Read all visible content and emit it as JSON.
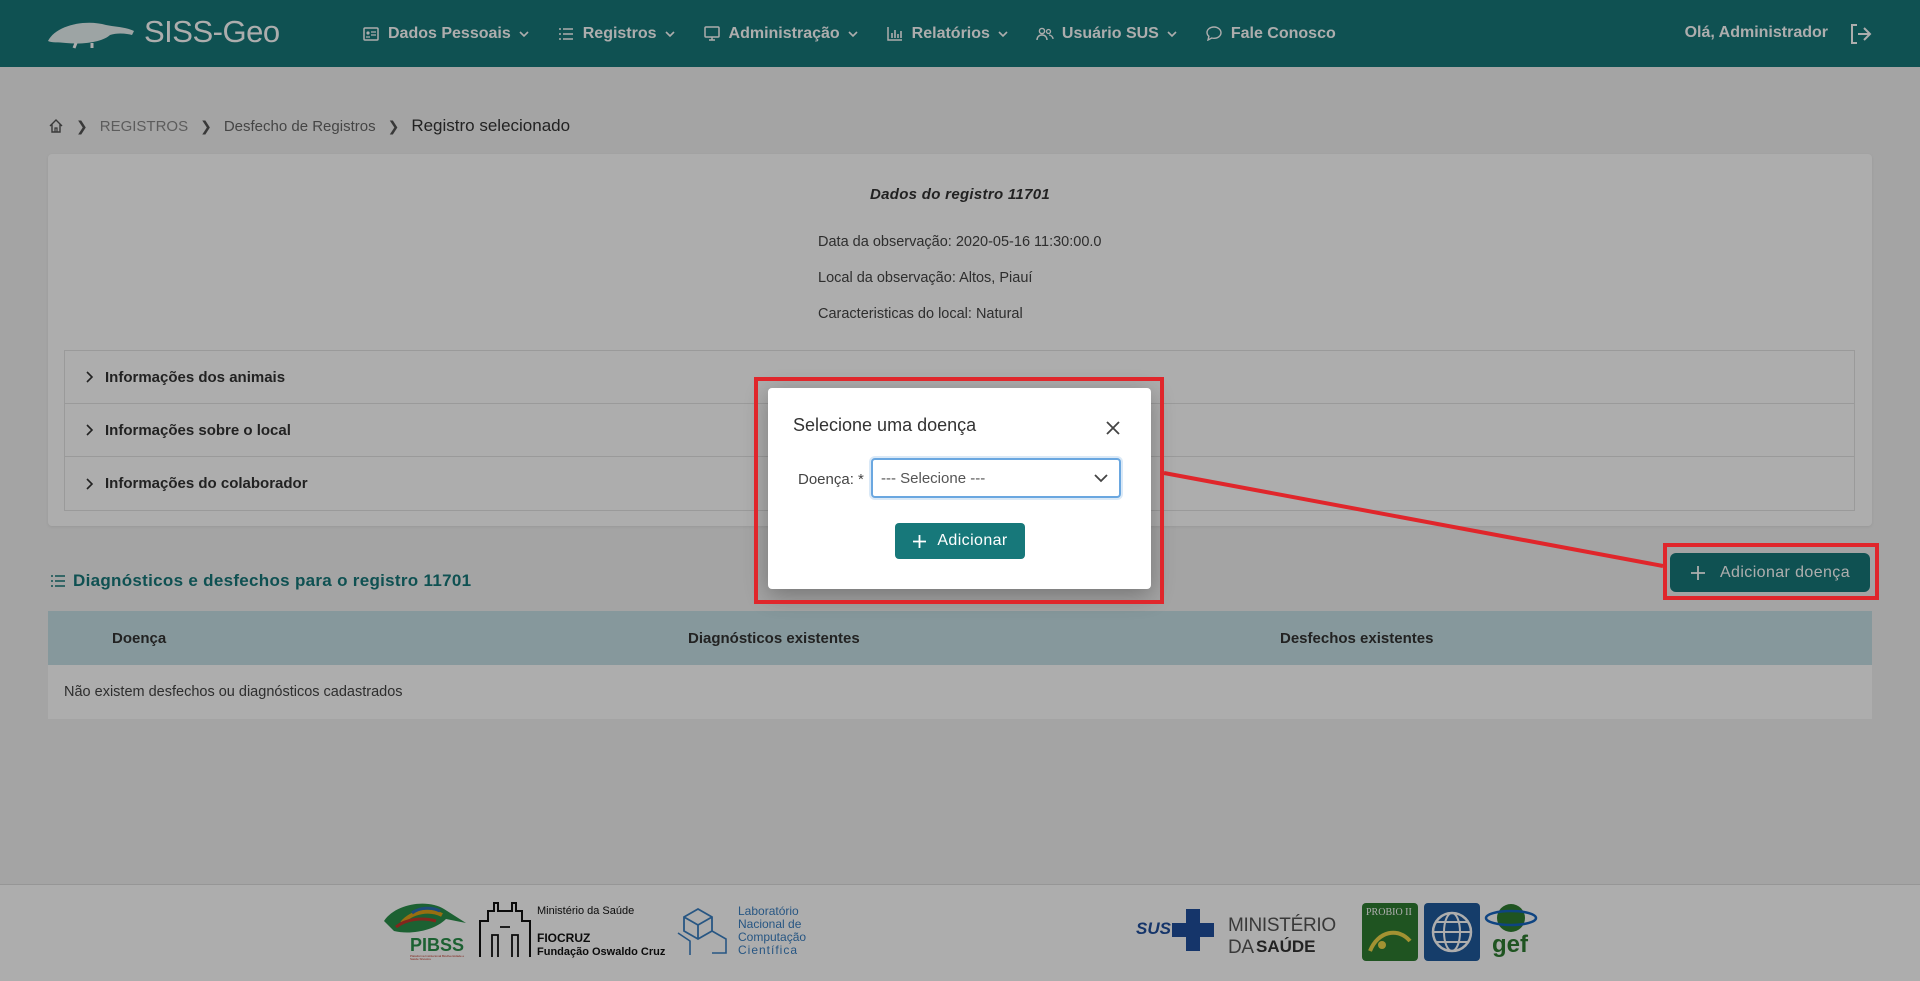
{
  "navbar": {
    "brand": "SISS-Geo",
    "items": [
      {
        "label": "Dados Pessoais",
        "icon": "id-card-icon"
      },
      {
        "label": "Registros",
        "icon": "list-icon"
      },
      {
        "label": "Administração",
        "icon": "monitor-icon"
      },
      {
        "label": "Relatórios",
        "icon": "bar-chart-icon"
      },
      {
        "label": "Usuário SUS",
        "icon": "users-icon"
      },
      {
        "label": "Fale Conosco",
        "icon": "chat-icon"
      }
    ],
    "greeting": "Olá, Administrador"
  },
  "breadcrumb": {
    "level1": "REGISTROS",
    "level2": "Desfecho de Registros",
    "current": "Registro selecionado"
  },
  "record": {
    "title": "Dados do registro 11701",
    "observation_date": "Data da observação: 2020-05-16 11:30:00.0",
    "observation_place": "Local da observação: Altos, Piauí",
    "place_characteristics": "Caracteristicas do local: Natural"
  },
  "accordion": [
    "Informações dos animais",
    "Informações sobre o local",
    "Informações do colaborador"
  ],
  "section": {
    "title": "Diagnósticos e desfechos para o registro 11701",
    "add_button": "Adicionar doença"
  },
  "table": {
    "headers": [
      "Doença",
      "Diagnósticos existentes",
      "Desfechos existentes"
    ],
    "empty_message": "Não existem desfechos ou diagnósticos cadastrados"
  },
  "modal": {
    "title": "Selecione uma doença",
    "field_label": "Doença: *",
    "select_value": "--- Selecione ---",
    "add_button": "Adicionar"
  },
  "footer": {
    "pibss": "PIBSS",
    "pibss_sub": "Plataforma Institucional Biodiversidade e Saúde Silvestre",
    "ministry_small": "Ministério da Saúde",
    "fiocruz": "FIOCRUZ",
    "fiocruz_sub": "Fundação Oswaldo Cruz",
    "lab_line1": "Laboratório",
    "lab_line2": "Nacional de",
    "lab_line3": "Computação",
    "lab_line4": "Científica",
    "sus": "SUS",
    "ministry_big1": "MINISTÉRIO DA",
    "ministry_big2": "SAÚDE",
    "probio": "PROBIO II",
    "gef": "gef"
  },
  "colors": {
    "primary": "#17787a",
    "highlight": "#e0262b",
    "table_header": "#c6e1e6"
  }
}
